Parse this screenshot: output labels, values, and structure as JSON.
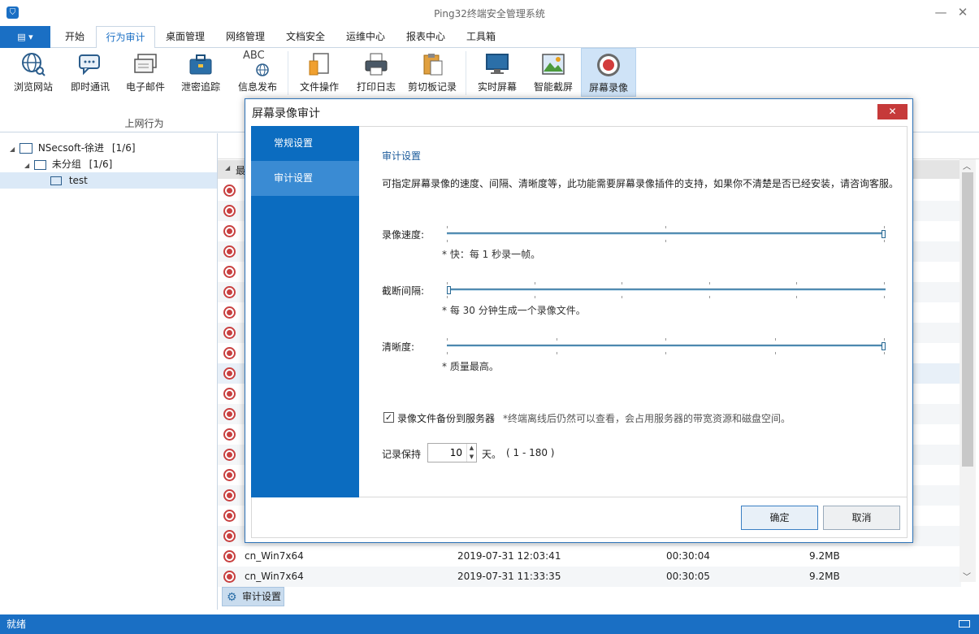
{
  "window": {
    "title": "Ping32终端安全管理系统"
  },
  "menu": {
    "file_label": "▤ ▾",
    "tabs": [
      {
        "label": "开始"
      },
      {
        "label": "行为审计"
      },
      {
        "label": "桌面管理"
      },
      {
        "label": "网络管理"
      },
      {
        "label": "文档安全"
      },
      {
        "label": "运维中心"
      },
      {
        "label": "报表中心"
      },
      {
        "label": "工具箱"
      }
    ]
  },
  "ribbon": {
    "buttons": [
      {
        "label": "浏览网站",
        "icon": "globe-icon"
      },
      {
        "label": "即时通讯",
        "icon": "chat-icon"
      },
      {
        "label": "电子邮件",
        "icon": "email-icon"
      },
      {
        "label": "泄密追踪",
        "icon": "briefcase-icon"
      },
      {
        "label": "信息发布",
        "icon": "abc-globe-icon",
        "icon_text": "ABC"
      },
      {
        "label": "文件操作",
        "icon": "file-icon"
      },
      {
        "label": "打印日志",
        "icon": "printer-icon"
      },
      {
        "label": "剪切板记录",
        "icon": "clipboard-icon"
      },
      {
        "label": "实时屏幕",
        "icon": "monitor-icon"
      },
      {
        "label": "智能截屏",
        "icon": "picture-icon"
      },
      {
        "label": "屏幕录像",
        "icon": "record-icon"
      }
    ],
    "group_label": "上网行为"
  },
  "tree": {
    "nodes": [
      {
        "label": "NSecsoft-徐进",
        "count": "[1/6]"
      },
      {
        "label": "未分组",
        "count": "[1/6]"
      },
      {
        "label": "test"
      }
    ]
  },
  "list": {
    "header_partial": "最",
    "rows": [
      {
        "name": "",
        "time": "",
        "duration": "",
        "size": ""
      },
      {
        "name": "",
        "time": "",
        "duration": "",
        "size": ""
      },
      {
        "name": "",
        "time": "",
        "duration": "",
        "size": ""
      },
      {
        "name": "",
        "time": "",
        "duration": "",
        "size": ""
      },
      {
        "name": "",
        "time": "",
        "duration": "",
        "size": ""
      },
      {
        "name": "",
        "time": "",
        "duration": "",
        "size": ""
      },
      {
        "name": "",
        "time": "",
        "duration": "",
        "size": ""
      },
      {
        "name": "",
        "time": "",
        "duration": "",
        "size": ""
      },
      {
        "name": "",
        "time": "",
        "duration": "",
        "size": ""
      },
      {
        "name": "",
        "time": "",
        "duration": "",
        "size": ""
      },
      {
        "name": "",
        "time": "",
        "duration": "",
        "size": ""
      },
      {
        "name": "",
        "time": "",
        "duration": "",
        "size": ""
      },
      {
        "name": "",
        "time": "",
        "duration": "",
        "size": ""
      },
      {
        "name": "",
        "time": "",
        "duration": "",
        "size": ""
      },
      {
        "name": "",
        "time": "",
        "duration": "",
        "size": ""
      },
      {
        "name": "",
        "time": "",
        "duration": "",
        "size": ""
      },
      {
        "name": "",
        "time": "",
        "duration": "",
        "size": ""
      },
      {
        "name": "",
        "time": "",
        "duration": "",
        "size": ""
      },
      {
        "name": "cn_Win7x64",
        "time": "2019-07-31 12:03:41",
        "duration": "00:30:04",
        "size": "9.2MB"
      },
      {
        "name": "cn_Win7x64",
        "time": "2019-07-31 11:33:35",
        "duration": "00:30:05",
        "size": "9.2MB"
      }
    ]
  },
  "bottom_tab": {
    "label": "审计设置"
  },
  "status": {
    "text": "就绪"
  },
  "dialog": {
    "title": "屏幕录像审计",
    "nav": [
      {
        "label": "常规设置"
      },
      {
        "label": "审计设置"
      }
    ],
    "section_title": "审计设置",
    "description": "可指定屏幕录像的速度、间隔、清晰度等，此功能需要屏幕录像插件的支持，如果你不清楚是否已经安装，请咨询客服。",
    "sliders": [
      {
        "label": "录像速度:",
        "note": "* 快：每 1 秒录一帧。",
        "value": 1.0
      },
      {
        "label": "截断间隔:",
        "note": "* 每 30 分钟生成一个录像文件。",
        "value": 0.0
      },
      {
        "label": "清晰度:",
        "note": "* 质量最高。",
        "value": 1.0
      }
    ],
    "backup": {
      "checked": true,
      "label": "录像文件备份到服务器",
      "hint": "*终端离线后仍然可以查看，会占用服务器的带宽资源和磁盘空间。"
    },
    "retention": {
      "label": "记录保持",
      "value": "10",
      "unit": "天。",
      "range": "( 1 - 180 )"
    },
    "ok_label": "确定",
    "cancel_label": "取消"
  }
}
